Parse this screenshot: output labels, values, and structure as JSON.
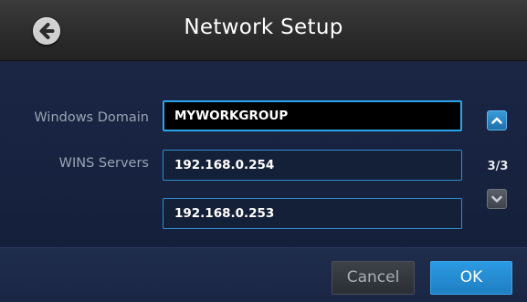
{
  "header": {
    "title": "Network Setup",
    "back_icon": "back-arrow-icon"
  },
  "form": {
    "windows_domain": {
      "label": "Windows Domain",
      "value": "MYWORKGROUP"
    },
    "wins_servers": {
      "label": "WINS Servers",
      "values": [
        "192.168.0.254",
        "192.168.0.253"
      ]
    }
  },
  "pager": {
    "up_icon": "chevron-up-icon",
    "down_icon": "chevron-down-icon",
    "page": "3/3"
  },
  "footer": {
    "cancel_label": "Cancel",
    "ok_label": "OK"
  },
  "colors": {
    "accent": "#2a9be3",
    "background": "#16213a",
    "header": "#2f2f2f"
  }
}
